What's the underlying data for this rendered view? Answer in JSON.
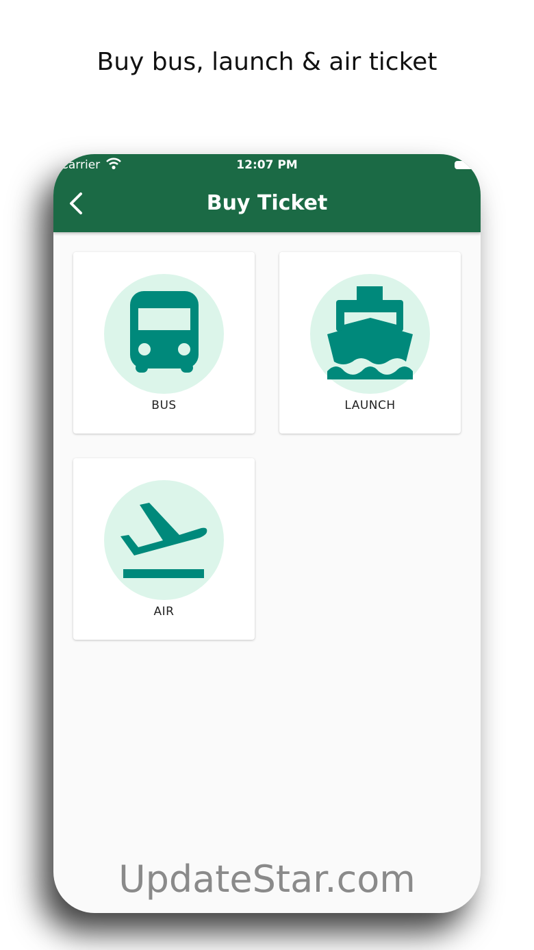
{
  "caption": "Buy bus, launch & air ticket",
  "status_bar": {
    "carrier": "Carrier",
    "time": "12:07 PM"
  },
  "header": {
    "title": "Buy Ticket"
  },
  "tickets": [
    {
      "label": "BUS",
      "icon": "bus-icon"
    },
    {
      "label": "LAUNCH",
      "icon": "ship-icon"
    },
    {
      "label": "AIR",
      "icon": "flight-takeoff-icon"
    }
  ],
  "watermark": "UpdateStar.com",
  "colors": {
    "header": "#1b6a45",
    "icon": "#00897b",
    "icon_bg": "#dcf5ea"
  }
}
